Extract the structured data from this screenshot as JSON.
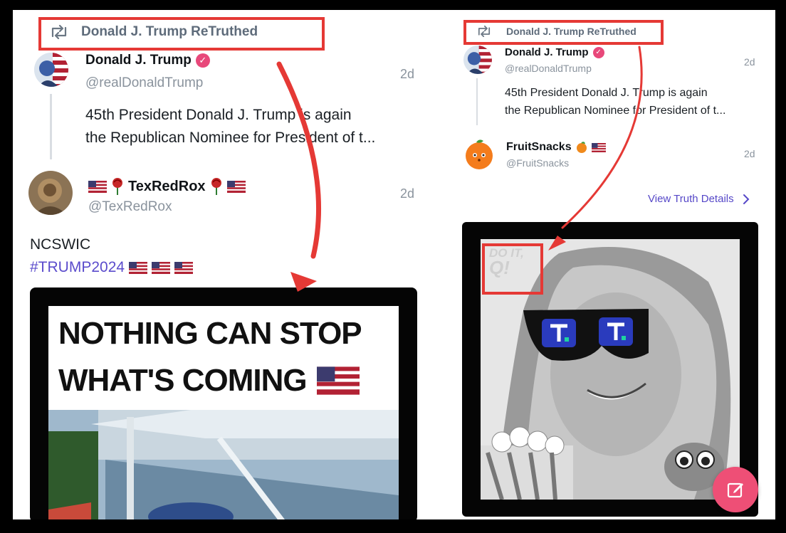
{
  "left": {
    "retruth_label": "Donald J. Trump ReTruthed",
    "original_post": {
      "author": "Donald J. Trump",
      "handle": "@realDonaldTrump",
      "time": "2d",
      "text_line1": "45th President Donald J. Trump is again",
      "text_line2": "the Republican Nominee for President of t..."
    },
    "retruth_post": {
      "author": "TexRedRox",
      "handle": "@TexRedRox",
      "time": "2d",
      "body": "NCSWIC",
      "hashtag": "#TRUMP2024"
    },
    "video_caption_line1": "NOTHING CAN STOP",
    "video_caption_line2": "WHAT'S COMING"
  },
  "right": {
    "retruth_label": "Donald J. Trump ReTruthed",
    "original_post": {
      "author": "Donald J. Trump",
      "handle": "@realDonaldTrump",
      "time": "2d",
      "text_line1": "45th President Donald J. Trump is again",
      "text_line2": "the Republican Nominee for President of t..."
    },
    "reply_post": {
      "author": "FruitSnacks",
      "handle": "@FruitSnacks",
      "time": "2d"
    },
    "view_details": "View Truth Details",
    "image_text_line1": "DO IT,",
    "image_text_line2": "Q!"
  },
  "colors": {
    "highlight": "#e53935",
    "verified_badge": "#e8487a",
    "hashtag": "#5b4ccc",
    "compose_button": "#ee4f76"
  },
  "icons": [
    "retruth-icon",
    "verified-icon",
    "us-flag-icon",
    "rose-icon",
    "orange-icon",
    "chevron-right-icon",
    "compose-icon"
  ]
}
